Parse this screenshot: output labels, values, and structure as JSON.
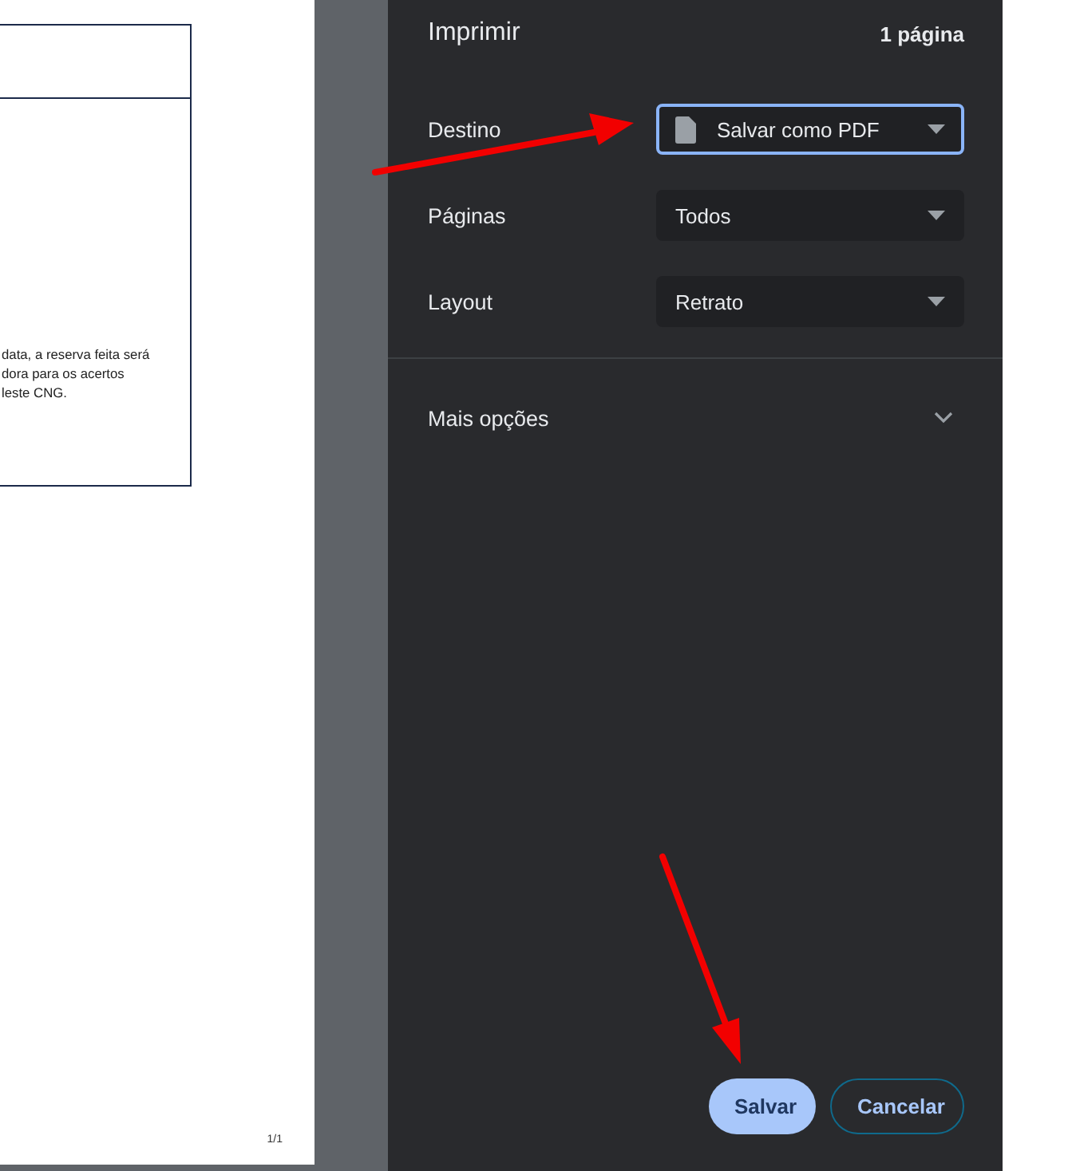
{
  "preview": {
    "text_lines": [
      "data, a reserva feita será",
      "dora para os acertos",
      "leste CNG."
    ],
    "page_number": "1/1"
  },
  "panel": {
    "title": "Imprimir",
    "page_count": "1 página",
    "settings": [
      {
        "label": "Destino",
        "value": "Salvar como PDF",
        "kind": "destination",
        "focused": true
      },
      {
        "label": "Páginas",
        "value": "Todos",
        "kind": "select",
        "focused": false
      },
      {
        "label": "Layout",
        "value": "Retrato",
        "kind": "select",
        "focused": false
      }
    ],
    "more_options": {
      "label": "Mais opções",
      "expanded": false
    },
    "buttons": [
      {
        "label": "Salvar",
        "kind": "primary"
      },
      {
        "label": "Cancelar",
        "kind": "secondary"
      }
    ]
  }
}
